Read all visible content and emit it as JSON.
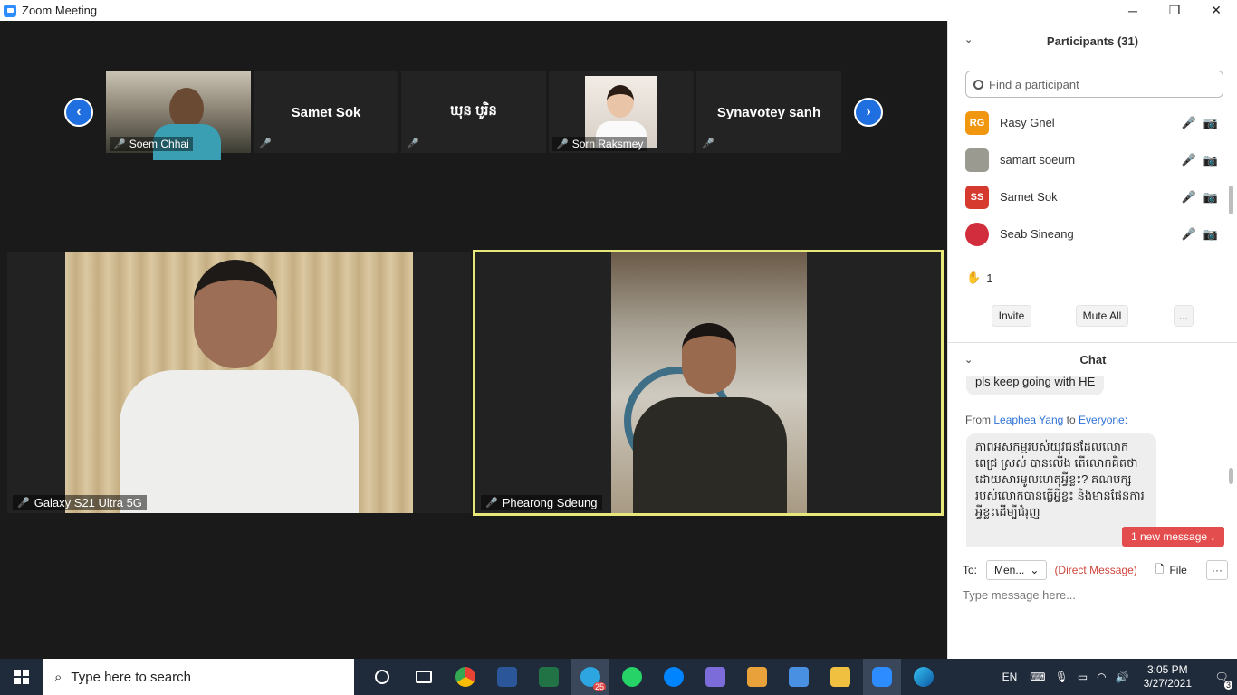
{
  "window": {
    "title": "Zoom Meeting",
    "controls": [
      "─",
      "❐",
      "✕"
    ]
  },
  "gallery": {
    "thumbnails": [
      {
        "name": "Soem Chhai",
        "type": "video"
      },
      {
        "name": "Samet Sok",
        "type": "name"
      },
      {
        "name": "ឃុន បូរិន",
        "type": "name"
      },
      {
        "name": "Sorn Raksmey",
        "type": "photo"
      },
      {
        "name": "Synavotey sanh",
        "type": "name"
      }
    ],
    "prev_arrow": "‹",
    "next_arrow": "›",
    "tiles": [
      {
        "name": "Galaxy S21 Ultra 5G"
      },
      {
        "name": "Phearong Sdeung"
      }
    ]
  },
  "participants": {
    "title": "Participants (31)",
    "search_placeholder": "Find a participant",
    "list": [
      {
        "initials": "RG",
        "name": "Rasy Gnel",
        "color": "#f0960f"
      },
      {
        "initials": "",
        "name": "samart soeurn",
        "color": "#9b9a91"
      },
      {
        "initials": "SS",
        "name": "Samet Sok",
        "color": "#d63a2f"
      },
      {
        "initials": "",
        "name": "Seab Sineang",
        "color": "#d22d3d"
      }
    ],
    "raised_hands": "1",
    "buttons": [
      "Invite",
      "Mute All",
      "..."
    ]
  },
  "chat": {
    "title": "Chat",
    "prev_message": "pls keep going with HE",
    "from_prefix": "From",
    "from_name": "Leaphea Yang",
    "to_word": "to",
    "to_name": "Everyone:",
    "message": "ភាពអសកម្មរបស់យុវជនដែលលោកពេជ្រ ស្រស់ បានលើង តើលោកគិតថាដោយសារមូលហេតុអ្វីខ្លះ? គណបក្សរបស់លោកបានធ្វើអ្វីខ្លះ និងមានផែនការអ្វីខ្លះដើម្បីជំរុញ",
    "new_message": "1 new message ↓",
    "to_label": "To:",
    "to_select": "Men...",
    "direct_message": "(Direct Message)",
    "file_label": "File",
    "more": "···",
    "input_placeholder": "Type message here..."
  },
  "taskbar": {
    "search_placeholder": "Type here to search",
    "apps": [
      "task-view",
      "chrome",
      "word",
      "excel",
      "telegram",
      "whatsapp",
      "messenger",
      "video-editor",
      "paint",
      "photos",
      "file-explorer",
      "zoom",
      "edge"
    ],
    "telegram_badge": "25",
    "lang": "EN",
    "time": "3:05 PM",
    "date": "3/27/2021",
    "notification_count": "3"
  }
}
